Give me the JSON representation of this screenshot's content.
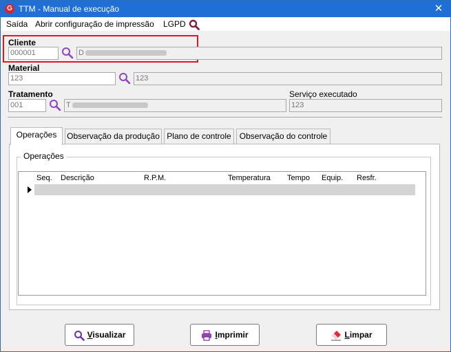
{
  "window": {
    "title": "TTM - Manual de execução",
    "app_icon_letter": "G",
    "close_label": "✕"
  },
  "menu": {
    "items": [
      "Saída",
      "Abrir configuração de impressão",
      "LGPD"
    ]
  },
  "form": {
    "cliente": {
      "label": "Cliente",
      "code": "000001",
      "name_prefix": "D"
    },
    "material": {
      "label": "Material",
      "code": "123",
      "description": "123"
    },
    "tratamento": {
      "label": "Tratamento",
      "code": "001",
      "name_prefix": "T"
    },
    "servico": {
      "label": "Serviço executado",
      "value": "123"
    }
  },
  "tabs": [
    "Operações",
    "Observação da produção",
    "Plano de controle",
    "Observação do controle"
  ],
  "operacoes": {
    "group_title": "Operações",
    "columns": [
      "Seq.",
      "Descrição",
      "R.P.M.",
      "Temperatura",
      "Tempo",
      "Equip.",
      "Resfr."
    ]
  },
  "buttons": {
    "visualizar": {
      "mnemonic": "V",
      "rest": "isualizar"
    },
    "imprimir": {
      "mnemonic": "I",
      "rest": "mprimir"
    },
    "limpar": {
      "mnemonic": "L",
      "rest": "impar"
    }
  },
  "colors": {
    "titlebar": "#1f6fd6",
    "highlight": "#e3161e",
    "search_icon": "#8e44c4"
  }
}
